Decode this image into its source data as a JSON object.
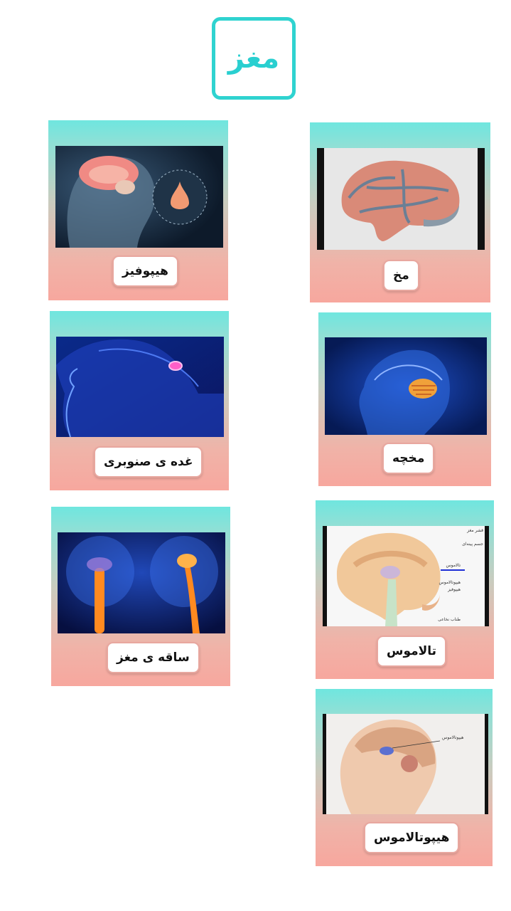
{
  "title": "مغز",
  "cards": [
    {
      "label": "هیپوفیز",
      "icon": "pituitary-gland-image"
    },
    {
      "label": "مخ",
      "icon": "cerebrum-image"
    },
    {
      "label": "غده ی صنوبری",
      "icon": "pineal-gland-image"
    },
    {
      "label": "مخچه",
      "icon": "cerebellum-image"
    },
    {
      "label": "ساقه ی مغز",
      "icon": "brainstem-image"
    },
    {
      "label": "تالاموس",
      "icon": "thalamus-diagram-image"
    },
    {
      "label": "هیپوتالاموس",
      "icon": "hypothalamus-diagram-image"
    }
  ],
  "thalamus_diagram": {
    "labels": [
      "قشر مغز",
      "جسم پینه‌ای",
      "تالاموس",
      "هیپوتالاموس",
      "هیپوفیز",
      "طناب نخاعی"
    ]
  },
  "hypothalamus_diagram": {
    "labels": [
      "هیپوتالاموس"
    ]
  }
}
